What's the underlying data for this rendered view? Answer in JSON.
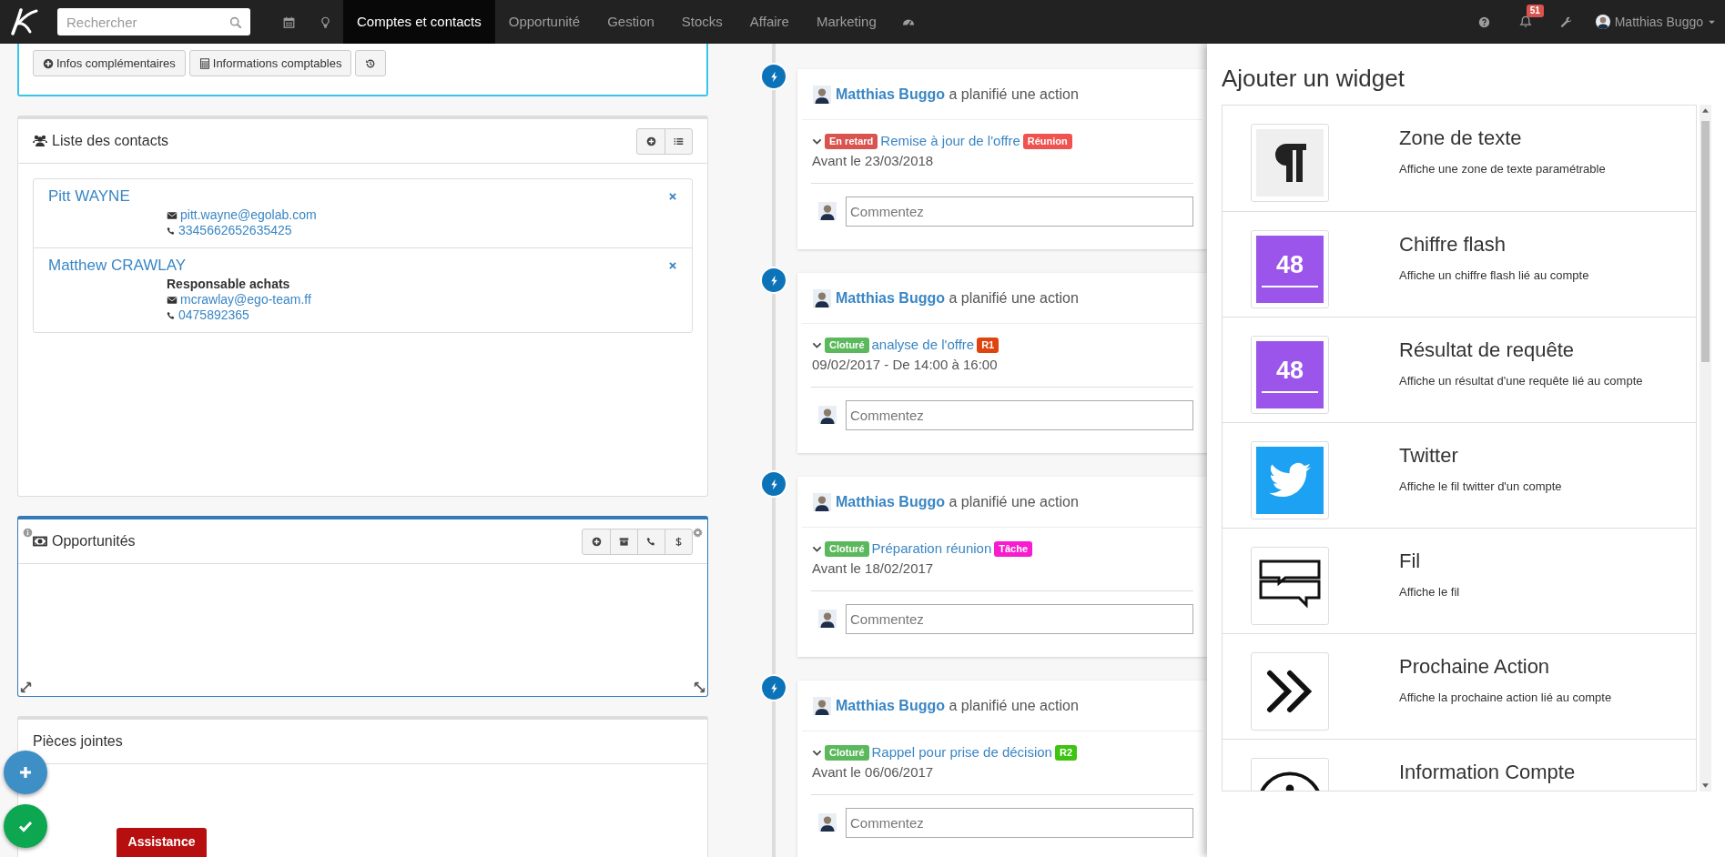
{
  "topbar": {
    "search": {
      "placeholder": "Rechercher"
    },
    "nav": [
      {
        "label": "Comptes et contacts",
        "selected": true
      },
      {
        "label": "Opportunité",
        "selected": false
      },
      {
        "label": "Gestion",
        "selected": false
      },
      {
        "label": "Stocks",
        "selected": false
      },
      {
        "label": "Affaire",
        "selected": false
      },
      {
        "label": "Marketing",
        "selected": false
      }
    ],
    "notification_count": "51",
    "user": "Matthias Buggo"
  },
  "account_panel": {
    "buttons": [
      {
        "kind": "plus",
        "label": "Infos complémentaires"
      },
      {
        "kind": "calculator",
        "label": "Informations comptables"
      },
      {
        "kind": "history"
      }
    ]
  },
  "contacts": {
    "title": "Liste des contacts",
    "items": [
      {
        "name": "Pitt WAYNE",
        "email": "pitt.wayne@egolab.com",
        "phone": "3345662652635425"
      },
      {
        "name": "Matthew CRAWLAY",
        "role": "Responsable achats",
        "email": "mcrawlay@ego-team.ff",
        "phone": "0475892365"
      }
    ]
  },
  "opportunities": {
    "title": "Opportunités"
  },
  "attachments": {
    "title": "Pièces jointes"
  },
  "assistance_button": "Assistance",
  "timeline": [
    {
      "author": "Matthias Buggo",
      "verb": "a planifié une action",
      "status": {
        "label": "En retard",
        "color": "#d9534f"
      },
      "title": "Remise à jour de l'offre",
      "tag": {
        "label": "Réunion",
        "color": "#f0524f"
      },
      "when": "Avant le 23/03/2018",
      "comment_placeholder": "Commentez"
    },
    {
      "author": "Matthias Buggo",
      "verb": "a planifié une action",
      "status": {
        "label": "Cloturé",
        "color": "#5cb85c"
      },
      "title": "analyse de l'offre",
      "tag": {
        "label": "R1",
        "color": "#e0440e"
      },
      "when": "09/02/2017 - De 14:00 à 16:00",
      "comment_placeholder": "Commentez"
    },
    {
      "author": "Matthias Buggo",
      "verb": "a planifié une action",
      "status": {
        "label": "Cloturé",
        "color": "#5cb85c"
      },
      "title": "Préparation réunion",
      "tag": {
        "label": "Tâche",
        "color": "#f71ccf"
      },
      "when": "Avant le 18/02/2017",
      "comment_placeholder": "Commentez"
    },
    {
      "author": "Matthias Buggo",
      "verb": "a planifié une action",
      "status": {
        "label": "Cloturé",
        "color": "#5cb85c"
      },
      "title": "Rappel pour prise de décision",
      "tag": {
        "label": "R2",
        "color": "#3cc40f"
      },
      "when": "Avant le 06/06/2017",
      "comment_placeholder": "Commentez"
    }
  ],
  "widget_panel": {
    "title": "Ajouter un widget",
    "widgets": [
      {
        "kind": "paragraph",
        "name": "Zone de texte",
        "description": "Affiche une zone de texte paramétrable"
      },
      {
        "kind": "number",
        "number": "48",
        "name": "Chiffre flash",
        "description": "Affiche un chiffre flash lié au compte"
      },
      {
        "kind": "number",
        "number": "48",
        "name": "Résultat de requête",
        "description": "Affiche un résultat d'une requête lié au compte"
      },
      {
        "kind": "twitter",
        "name": "Twitter",
        "description": "Affiche le fil twitter d'un compte"
      },
      {
        "kind": "feed",
        "name": "Fil",
        "description": "Affiche le fil"
      },
      {
        "kind": "next",
        "name": "Prochaine Action",
        "description": "Affiche la prochaine action lié au compte"
      },
      {
        "kind": "info",
        "name": "Information Compte"
      }
    ]
  }
}
